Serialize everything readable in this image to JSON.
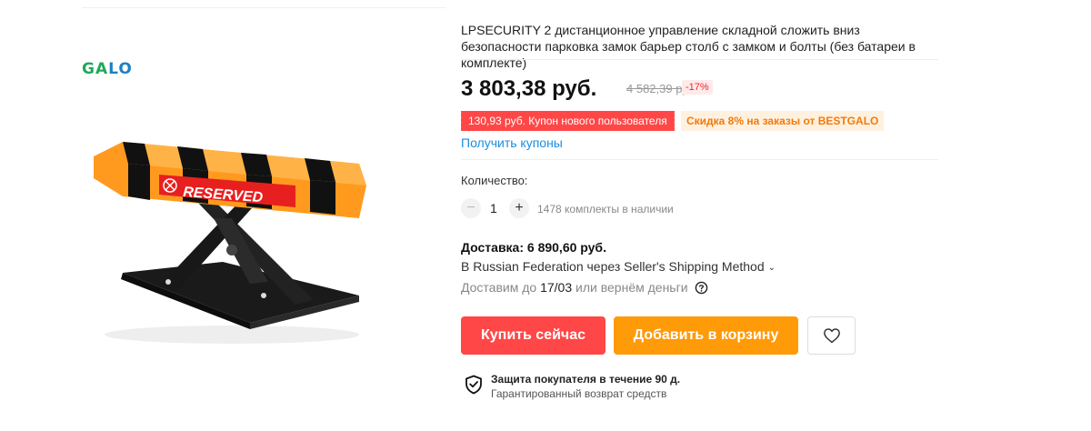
{
  "brand": {
    "logo_text": "GALO"
  },
  "product": {
    "title": "LPSECURITY 2 дистанционное управление складной сложить вниз безопасности парковка замок барьер столб с замком и болты (без батареи в комплекте)",
    "image_label": "RESERVED"
  },
  "price": {
    "current": "3 803,38 руб.",
    "old": "4 582,39 руб.",
    "discount": "-17%"
  },
  "coupons": {
    "new_user": "130,93 руб. Купон нового пользователя",
    "store": "Скидка 8% на заказы от BESTGALO",
    "get_link": "Получить купоны"
  },
  "quantity": {
    "label": "Количество:",
    "value": "1",
    "minus": "−",
    "plus": "+",
    "stock": "1478 комплекты в наличии"
  },
  "delivery": {
    "title": "Доставка: 6 890,60 руб.",
    "method": "В Russian Federation через Seller's Shipping Method",
    "date_prefix": "Доставим до ",
    "date": "17/03",
    "date_suffix": " или вернём деньги"
  },
  "actions": {
    "buy_now": "Купить сейчас",
    "add_to_cart": "Добавить в корзину"
  },
  "protection": {
    "title": "Защита покупателя в течение 90 д.",
    "subtitle": "Гарантированный возврат средств"
  },
  "icons": {
    "wishlist": "heart-icon",
    "help": "question-circle-icon",
    "shield": "shield-check-icon",
    "chevron": "chevron-down-icon"
  },
  "colors": {
    "red": "#ff4747",
    "orange": "#ff9a08",
    "link": "#1a8ee0",
    "logo_green": "#1ea85a",
    "logo_blue": "#1d7fc4"
  }
}
